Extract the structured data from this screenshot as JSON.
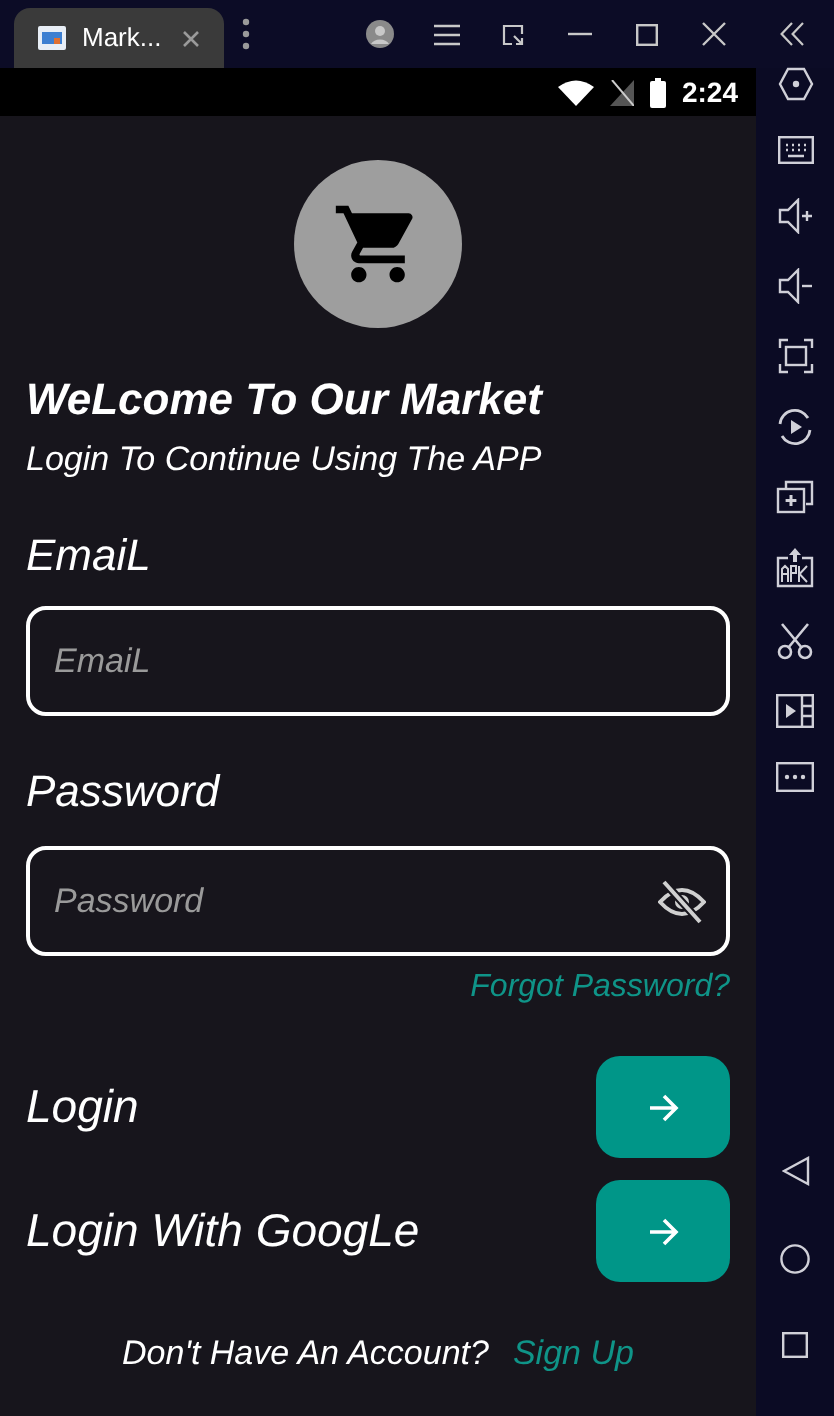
{
  "emulator_tab": {
    "title": "Mark..."
  },
  "status_bar": {
    "time": "2:24"
  },
  "header": {
    "title": "WeLcome To Our Market",
    "subtitle": "Login To Continue Using The APP"
  },
  "fields": [
    {
      "label": "EmaiL",
      "placeholder": "EmaiL",
      "kind": "text"
    },
    {
      "label": "Password",
      "placeholder": "Password",
      "kind": "password"
    }
  ],
  "forgot_link": "Forgot Password?",
  "actions": [
    {
      "label": "Login"
    },
    {
      "label": "Login With GoogLe"
    }
  ],
  "footer": {
    "text": "Don't Have An Account?",
    "link": "Sign Up"
  }
}
